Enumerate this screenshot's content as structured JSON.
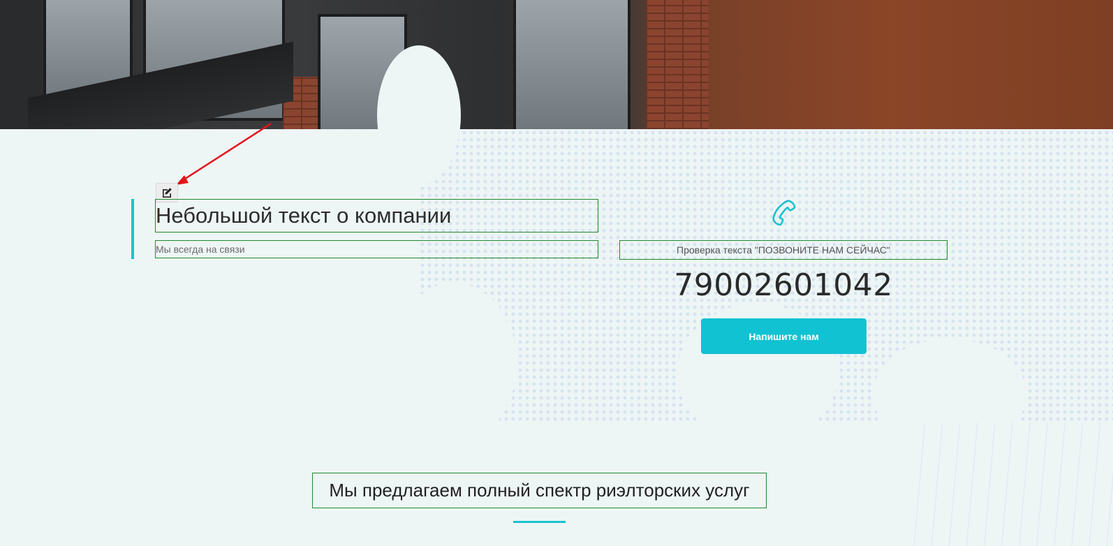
{
  "about": {
    "title": "Небольшой текст о компании",
    "subtitle": "Мы всегда на связи"
  },
  "contact": {
    "call_text": "Проверка текста \"ПОЗВОНИТЕ НАМ СЕЙЧАС\"",
    "phone": "79002601042",
    "write_button": "Напишите нам"
  },
  "services": {
    "heading": "Мы предлагаем полный спектр риэлторских услуг"
  },
  "icons": {
    "edit": "edit-icon",
    "phone": "phone-icon"
  },
  "colors": {
    "accent": "#19c2cf",
    "button": "#11c2d3",
    "outline": "#1f8a2e",
    "annotation": "#e3141b"
  }
}
